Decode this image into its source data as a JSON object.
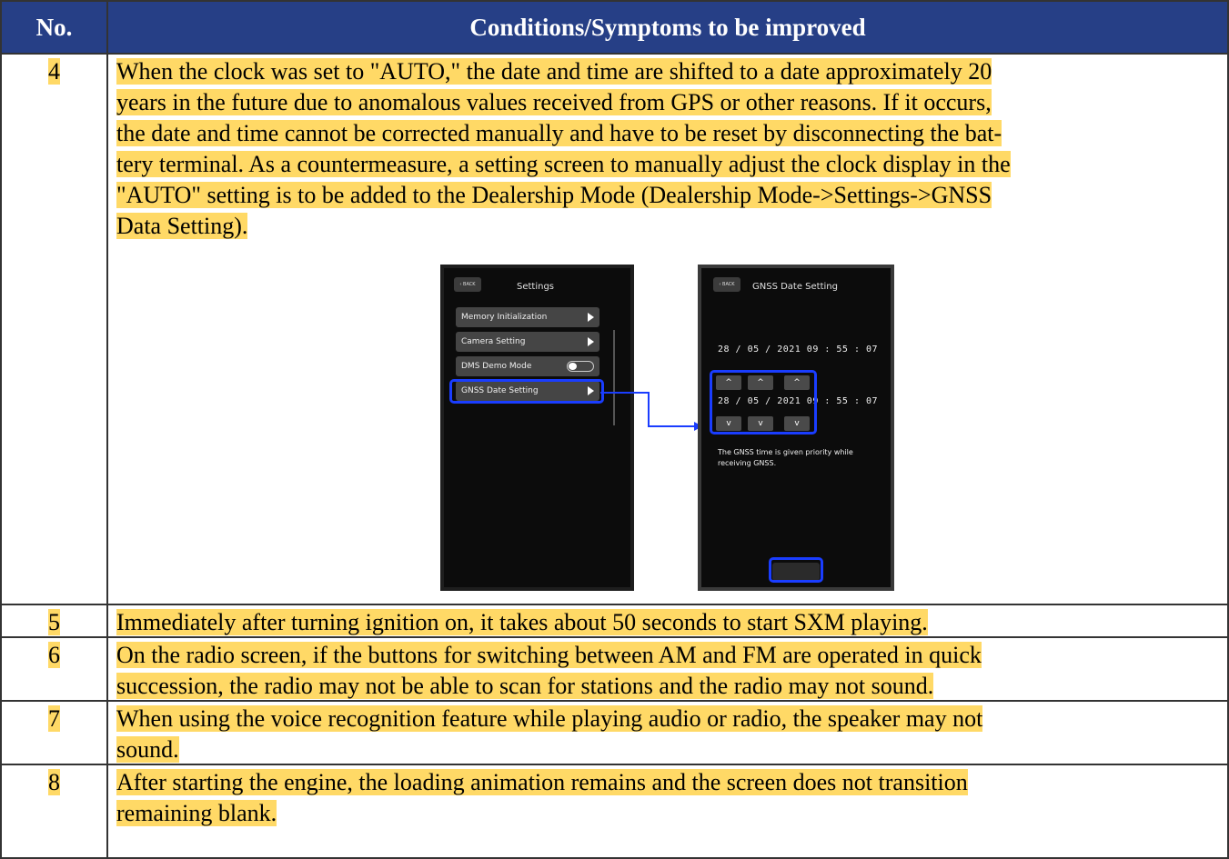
{
  "header": {
    "no": "No.",
    "conditions": "Conditions/Symptoms to be improved"
  },
  "rows": [
    {
      "no": "4",
      "text": "When the clock was set to \"AUTO,\" the date and time are shifted to a date approximately 20 years in the future due to anomalous values received from GPS or other reasons. If it occurs, the date and time cannot be corrected manually and have to be reset by disconnecting the battery terminal. As a countermeasure, a setting screen to manually adjust the clock display in the \"AUTO\" setting is to be added to the Dealership Mode (Dealership Mode->Settings->GNSS Data Setting)."
    },
    {
      "no": "5",
      "text": "Immediately after turning ignition on, it takes about 50 seconds to start SXM playing."
    },
    {
      "no": "6",
      "text": "On the radio screen, if the buttons for switching between AM and FM are operated in quick succession, the radio may not be able to scan for stations and the radio may not sound."
    },
    {
      "no": "7",
      "text": "When using the voice recognition feature while playing audio or radio,  the speaker may not sound."
    },
    {
      "no": "8",
      "text": "After starting the engine, the loading animation remains and the screen does not transition remaining blank."
    }
  ],
  "row4_lines": [
    "When the clock was set to \"AUTO,\" the date and time are shifted to a date approximately 20",
    "years in the future due to anomalous values received from GPS or other reasons. If it occurs,",
    "the date and time cannot be corrected manually and have to be reset by disconnecting the bat-",
    "tery terminal. As a countermeasure, a setting screen to manually adjust the clock display in the",
    "\"AUTO\" setting is to be added to the Dealership Mode (Dealership Mode->Settings->GNSS",
    "Data Setting)."
  ],
  "row6_lines": [
    "On the radio screen, if the buttons for switching between AM and FM are operated in quick",
    "succession, the radio may not be able to scan for stations and the radio may not sound."
  ],
  "row7_lines": [
    "When using the voice recognition feature while playing audio or radio,  the speaker may not",
    "sound."
  ],
  "row8_lines": [
    "After starting the engine, the loading animation remains and the screen does not transition",
    "remaining blank."
  ],
  "screen1": {
    "back": "BACK",
    "title": "Settings",
    "items": [
      "Memory Initialization",
      "Camera Setting",
      "DMS Demo Mode",
      "GNSS Date Setting"
    ]
  },
  "screen2": {
    "back": "BACK",
    "title": "GNSS Date Setting",
    "current_datetime": "28  /  05  /  2021   09 : 55 : 07",
    "edit_datetime": "28  /  05  /  2021   09 : 55 : 07",
    "up": "^",
    "down": "v",
    "note": "The GNSS time is given priority while receiving GNSS."
  },
  "colors": {
    "header_bg": "#263f86",
    "highlight": "#ffd966",
    "callout": "#1a3dff"
  }
}
